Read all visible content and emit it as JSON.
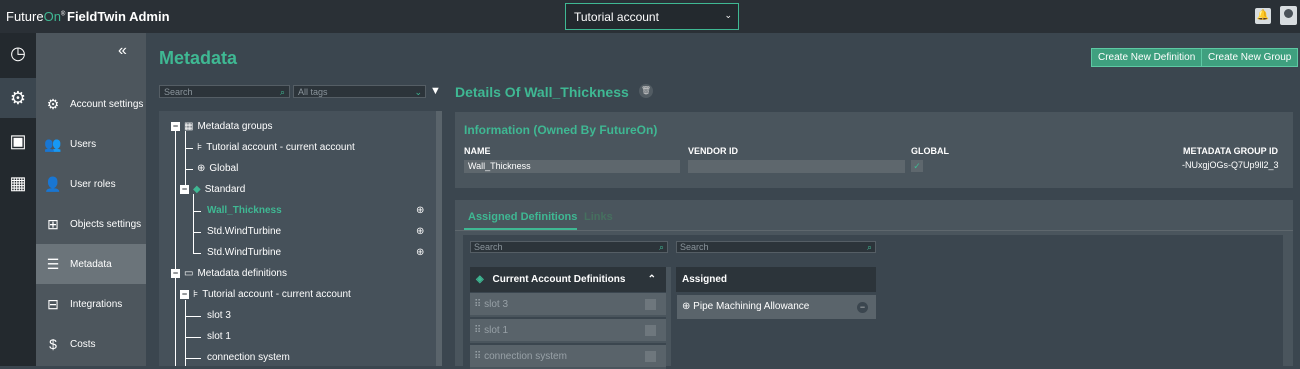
{
  "topbar": {
    "logo_future": "Future",
    "logo_on": "On",
    "logo_mark": "®",
    "app_title": "FieldTwin Admin",
    "account": "Tutorial account"
  },
  "rail": {
    "items": [
      "dashboard-icon",
      "gear-icon",
      "image-icon",
      "buildings-icon"
    ]
  },
  "sidebar": {
    "items": [
      {
        "label": "Account settings",
        "icon": "gear-icon"
      },
      {
        "label": "Users",
        "icon": "users-icon"
      },
      {
        "label": "User roles",
        "icon": "user-roles-icon"
      },
      {
        "label": "Objects settings",
        "icon": "hierarchy-icon"
      },
      {
        "label": "Metadata",
        "icon": "list-icon"
      },
      {
        "label": "Integrations",
        "icon": "table-icon"
      },
      {
        "label": "Costs",
        "icon": "dollar-icon"
      }
    ]
  },
  "main": {
    "title": "Metadata",
    "create_definition": "Create New Definition",
    "create_group": "Create New Group",
    "search_placeholder": "Search",
    "tags_placeholder": "All tags"
  },
  "tree": {
    "groups": "Metadata groups",
    "tutorial_account": "Tutorial account - current account",
    "global": "Global",
    "standard": "Standard",
    "wall_thickness": "Wall_Thickness",
    "wind1": "Std.WindTurbine",
    "wind2": "Std.WindTurbine",
    "definitions": "Metadata definitions",
    "tutorial_account2": "Tutorial account - current account",
    "slot3": "slot 3",
    "slot1": "slot 1",
    "connection_system": "connection system"
  },
  "details": {
    "title": "Details Of Wall_Thickness",
    "info_title": "Information (Owned By FutureOn)",
    "name_label": "NAME",
    "name_value": "Wall_Thickness",
    "vendor_label": "VENDOR ID",
    "vendor_value": "",
    "global_label": "GLOBAL",
    "global_check": "✓",
    "group_id_label": "METADATA GROUP ID",
    "group_id_value": "-NUxgjOGs-Q7Up9ll2_3"
  },
  "definitions": {
    "tab_assigned": "Assigned Definitions",
    "tab_links": "Links",
    "search_placeholder": "Search",
    "current_header": "Current Account Definitions",
    "assigned_header": "Assigned",
    "current_items": [
      "slot 3",
      "slot 1",
      "connection system"
    ],
    "assigned_items": [
      "Pipe Machining Allowance"
    ]
  },
  "colors": {
    "accent": "#3fb893",
    "topbar": "#2a3036",
    "panel": "#4a555d"
  }
}
